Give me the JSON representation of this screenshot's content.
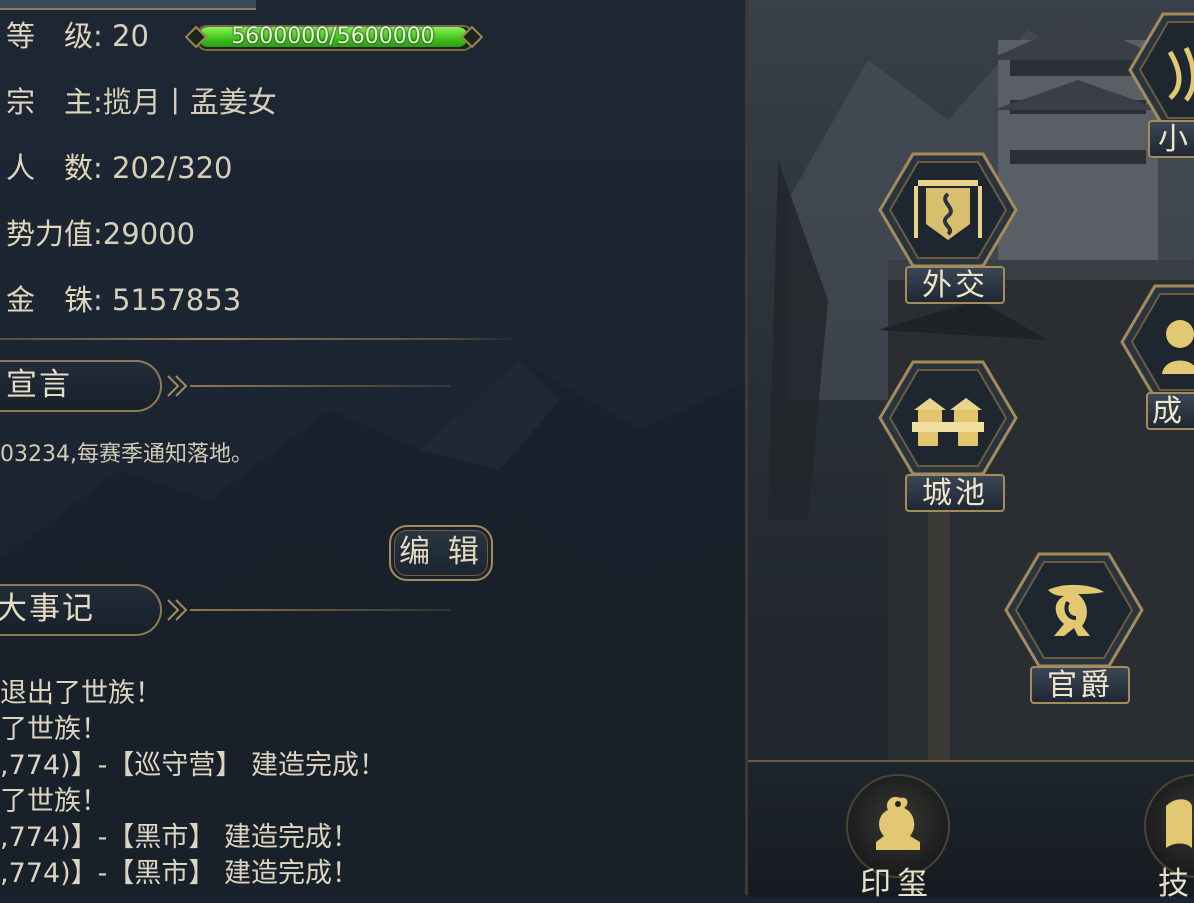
{
  "clan_info": {
    "level_label": "等　级",
    "level_value": "20",
    "exp_text": "5600000/5600000",
    "exp_fraction": 1.0,
    "leader_label": "宗　主",
    "leader_value": ":揽月丨孟姜女",
    "members_label": "人　数",
    "members_value": ": 202/320",
    "power_label": "势力值",
    "power_value": ":29000",
    "gold_label": "金　铢",
    "gold_value": ": 5157853"
  },
  "manifesto": {
    "section_title": "宣言",
    "text": "03234,每赛季通知落地。",
    "edit_button": "编 辑"
  },
  "events": {
    "section_title": "大事记",
    "items": [
      "退出了世族！",
      "了世族！",
      ",774)】-【巡守营】 建造完成！",
      "了世族！",
      ",774)】-【黑市】 建造完成！",
      ",774)】-【黑市】 建造完成！"
    ]
  },
  "buildings": {
    "diplomacy": "外交",
    "city": "城池",
    "rank": "官爵",
    "small_partial": "小",
    "achieve_partial": "成"
  },
  "bottom_bar": {
    "seal": "印玺",
    "skill_partial": "技"
  },
  "colors": {
    "gold_trim": "#a48b5a",
    "exp_green": "#43c71f",
    "panel_bg": "#1c2632"
  }
}
